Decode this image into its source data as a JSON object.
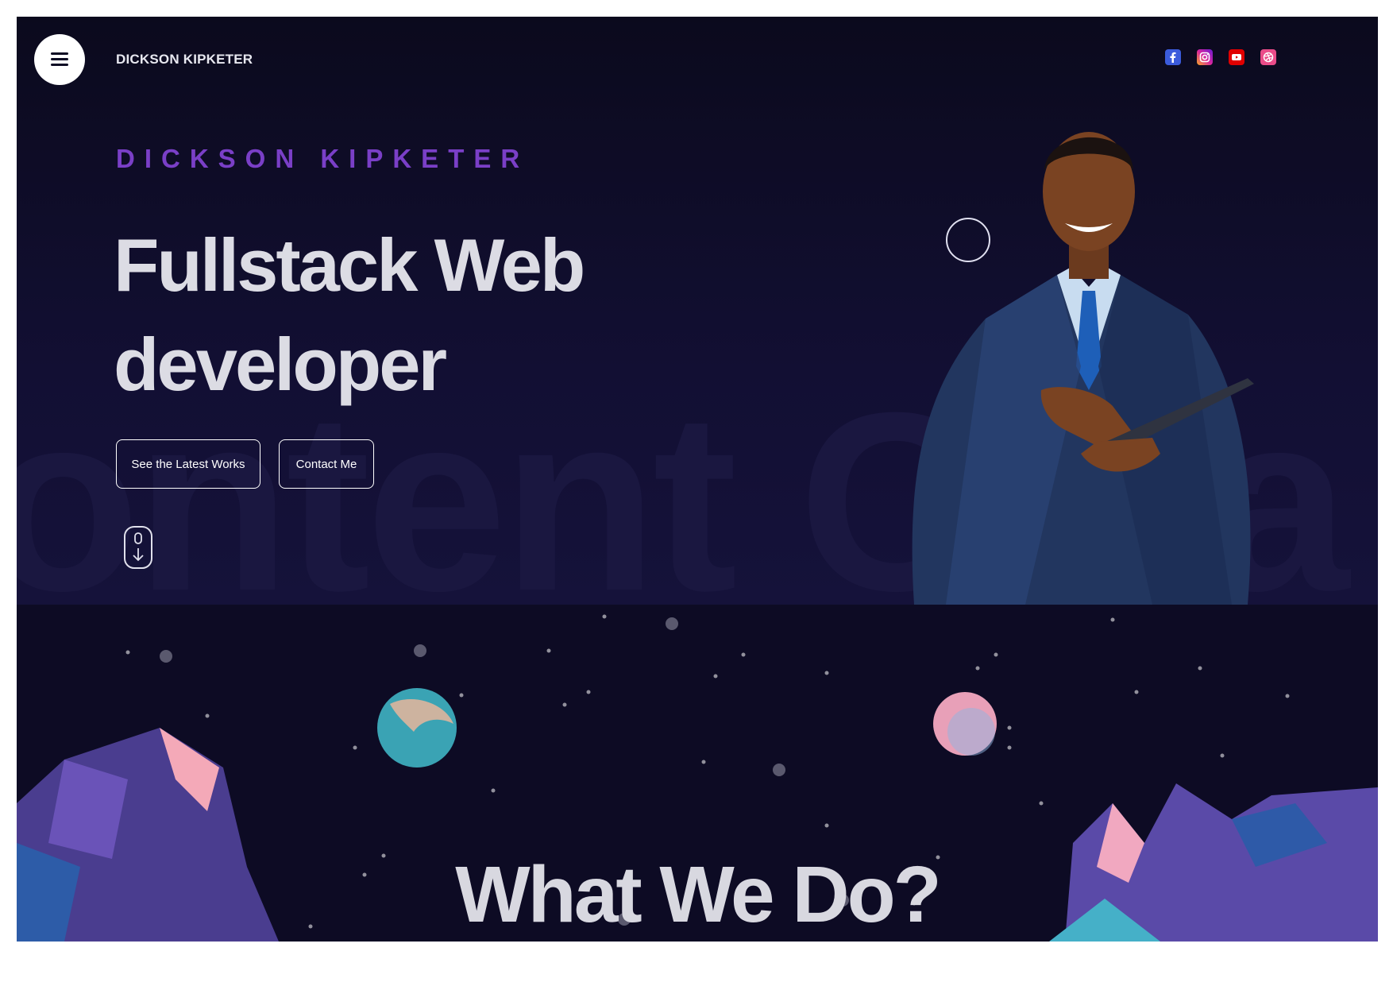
{
  "header": {
    "brand": "DICKSON KIPKETER",
    "menu_icon": "hamburger-icon",
    "socials": [
      {
        "name": "facebook-icon",
        "color": "#3b5bdb"
      },
      {
        "name": "instagram-icon",
        "color": "#d6249f"
      },
      {
        "name": "youtube-icon",
        "color": "#e00000"
      },
      {
        "name": "dribbble-icon",
        "color": "#ea4c89"
      }
    ]
  },
  "hero": {
    "eyebrow": "DICKSON KIPKETER",
    "headline_line1": "Fullstack Web",
    "headline_line2": "developer",
    "background_word": "ontent Crea",
    "buttons": {
      "works_label": "See the Latest Works",
      "contact_label": "Contact Me"
    },
    "scroll_icon": "mouse-scroll-icon"
  },
  "section": {
    "title": "What We Do?"
  },
  "colors": {
    "accent": "#7a3fc7",
    "background": "#0d0b24",
    "text": "#dcdce4"
  }
}
